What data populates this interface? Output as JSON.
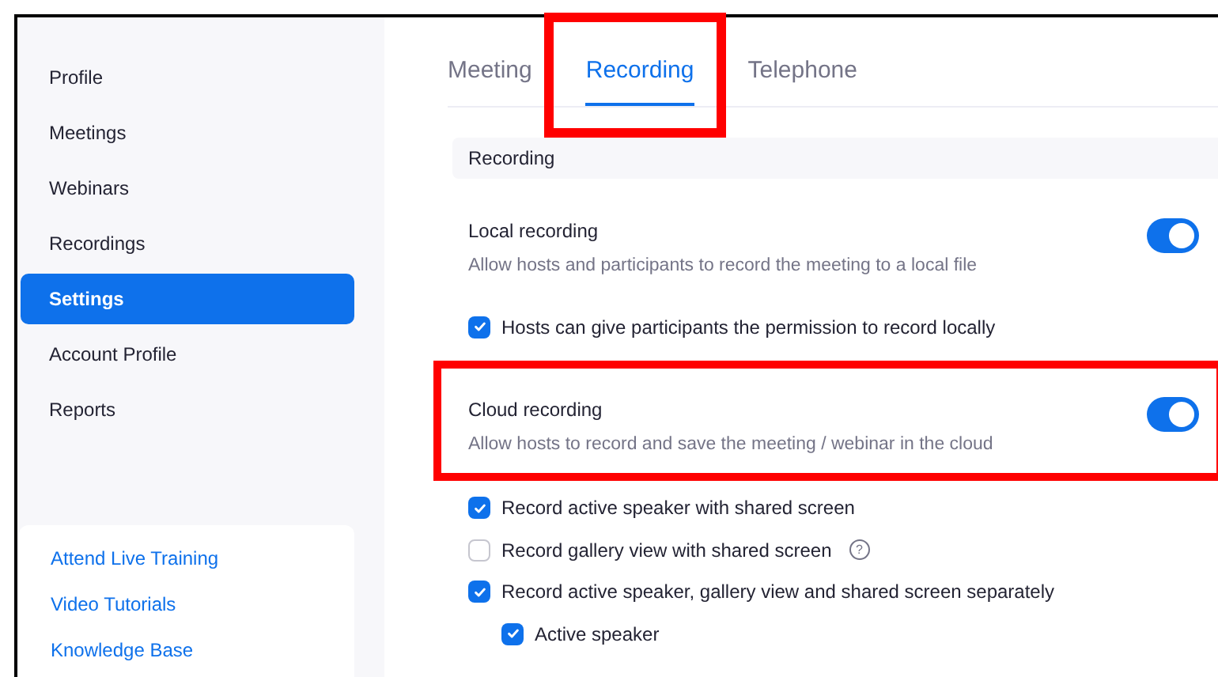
{
  "sidebar": {
    "items": [
      {
        "label": "Profile",
        "selected": false
      },
      {
        "label": "Meetings",
        "selected": false
      },
      {
        "label": "Webinars",
        "selected": false
      },
      {
        "label": "Recordings",
        "selected": false
      },
      {
        "label": "Settings",
        "selected": true
      },
      {
        "label": "Account Profile",
        "selected": false
      },
      {
        "label": "Reports",
        "selected": false
      }
    ],
    "links": [
      "Attend Live Training",
      "Video Tutorials",
      "Knowledge Base"
    ]
  },
  "tabs": [
    {
      "label": "Meeting",
      "selected": false,
      "highlighted": false
    },
    {
      "label": "Recording",
      "selected": true,
      "highlighted": true
    },
    {
      "label": "Telephone",
      "selected": false,
      "highlighted": false
    }
  ],
  "section": {
    "title": "Recording"
  },
  "settings": [
    {
      "title": "Local recording",
      "description": "Allow hosts and participants to record the meeting to a local file",
      "on": true,
      "highlighted": false,
      "options": [
        {
          "label": "Hosts can give participants the permission to record locally",
          "checked": true
        }
      ]
    },
    {
      "title": "Cloud recording",
      "description": "Allow hosts to record and save the meeting / webinar in the cloud",
      "on": true,
      "highlighted": true,
      "options": [
        {
          "label": "Record active speaker with shared screen",
          "checked": true
        },
        {
          "label": "Record gallery view with shared screen",
          "checked": false,
          "help": "?"
        },
        {
          "label": "Record active speaker, gallery view and shared screen separately",
          "checked": true,
          "children": [
            {
              "label": "Active speaker",
              "checked": true
            }
          ]
        }
      ]
    }
  ]
}
